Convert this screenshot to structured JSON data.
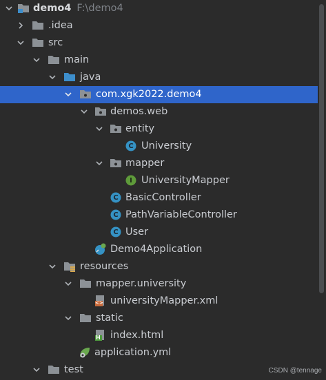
{
  "project_tree": {
    "root": {
      "label": "demo4",
      "path": "F:\\demo4"
    },
    "items": [
      {
        "label": ".idea"
      },
      {
        "label": "src"
      },
      {
        "label": "main"
      },
      {
        "label": "java"
      },
      {
        "label": "com.xgk2022.demo4"
      },
      {
        "label": "demos.web"
      },
      {
        "label": "entity"
      },
      {
        "label": "University"
      },
      {
        "label": "mapper"
      },
      {
        "label": "UniversityMapper"
      },
      {
        "label": "BasicController"
      },
      {
        "label": "PathVariableController"
      },
      {
        "label": "User"
      },
      {
        "label": "Demo4Application"
      },
      {
        "label": "resources"
      },
      {
        "label": "mapper.university"
      },
      {
        "label": "universityMapper.xml"
      },
      {
        "label": "static"
      },
      {
        "label": "index.html"
      },
      {
        "label": "application.yml"
      },
      {
        "label": "test"
      }
    ],
    "class_badge": "C",
    "interface_badge": "I",
    "html_badge": "H",
    "xml_badge": "<>"
  },
  "watermark": "CSDN @tennage",
  "colors": {
    "selection": "#2f65ca",
    "folder": "#8c9196",
    "source_folder": "#3d8ecb",
    "class_icon": "#3592c4",
    "interface_icon": "#5e9b3a",
    "xml_icon": "#c86a3b",
    "html_icon": "#4e9a3d",
    "spring_icon": "#6aa84f"
  }
}
